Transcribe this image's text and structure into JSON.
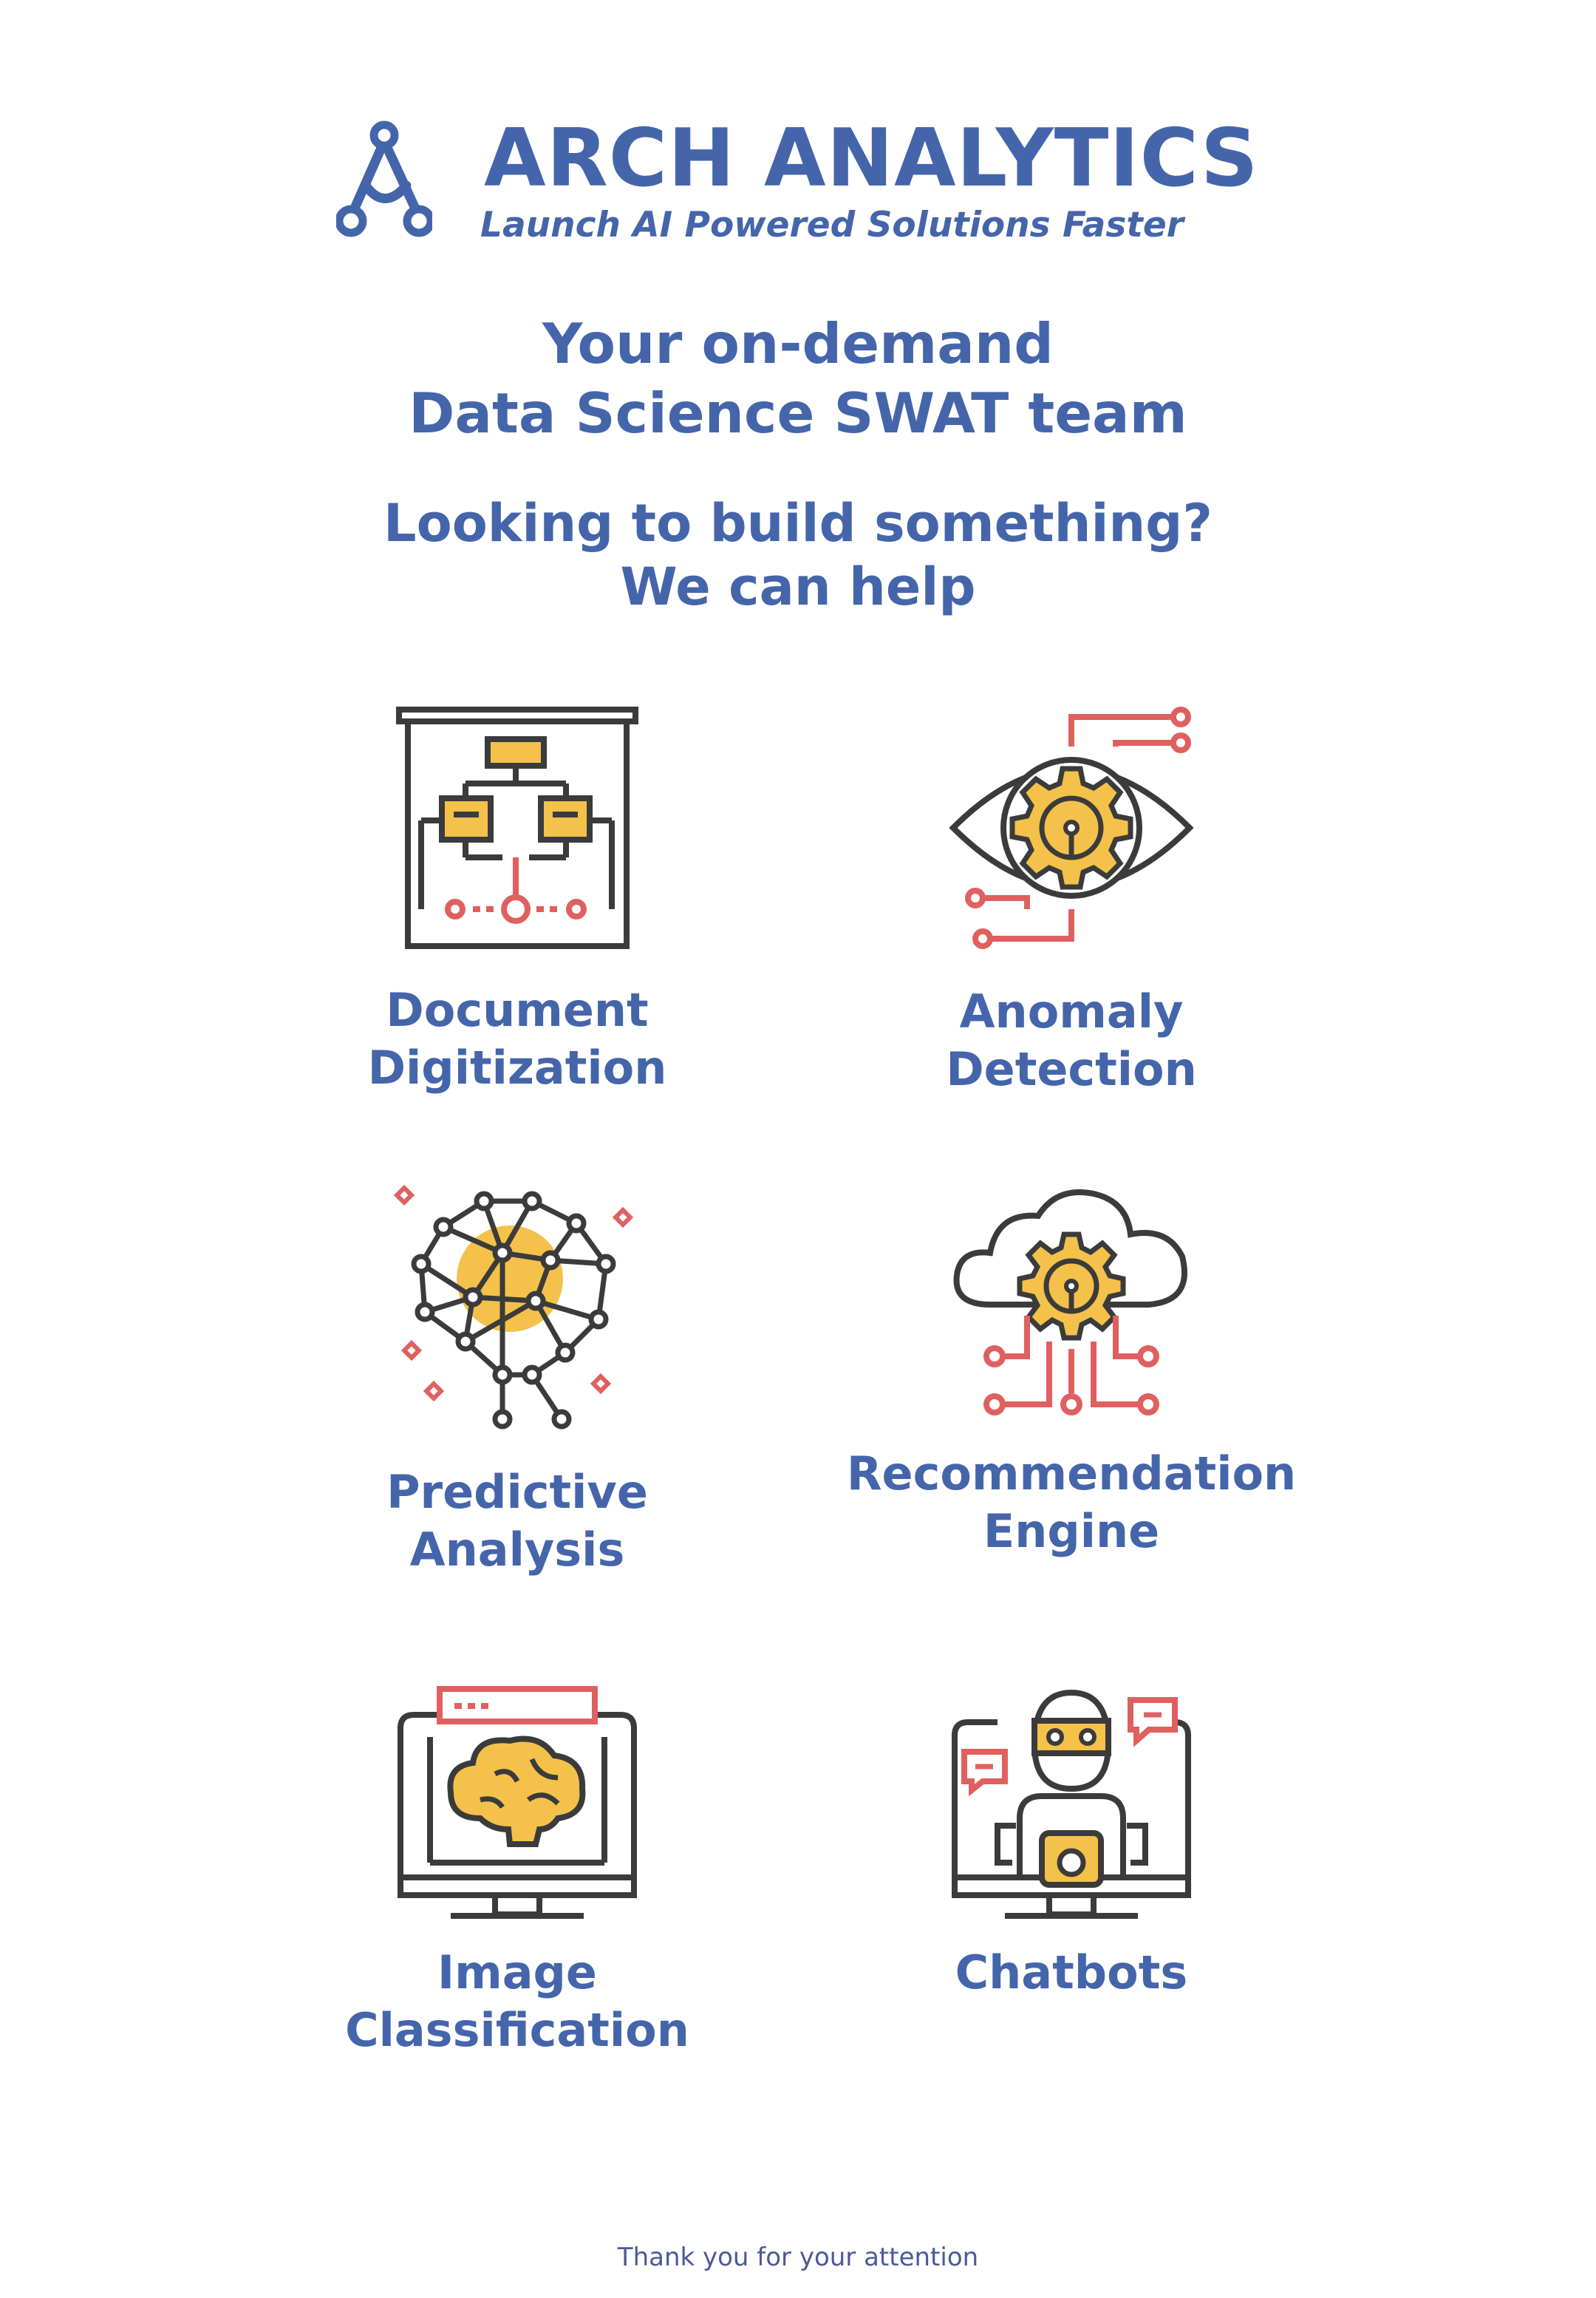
{
  "brand": {
    "name": "ARCH ANALYTICS",
    "tagline": "Launch AI Powered Solutions Faster"
  },
  "headline": {
    "line1": "Your on-demand",
    "line2": "Data Science SWAT team"
  },
  "subheadline": {
    "line1": "Looking to build something?",
    "line2": "We can help"
  },
  "services": [
    {
      "icon": "document-flowchart-icon",
      "line1": "Document",
      "line2": "Digitization"
    },
    {
      "icon": "eye-gear-icon",
      "line1": "Anomaly",
      "line2": "Detection"
    },
    {
      "icon": "neural-brain-icon",
      "line1": "Predictive",
      "line2": "Analysis"
    },
    {
      "icon": "cloud-gear-icon",
      "line1": "Recommendation",
      "line2": "Engine"
    },
    {
      "icon": "monitor-brain-icon",
      "line1": "Image",
      "line2": "Classification"
    },
    {
      "icon": "robot-chat-icon",
      "line1": "Chatbots",
      "line2": ""
    }
  ],
  "footer": {
    "text": "Thank you for your attention"
  },
  "colors": {
    "brand_blue": "#4565ab",
    "icon_dark": "#3b3b3b",
    "icon_yellow": "#f4c24a",
    "icon_red": "#e06060"
  }
}
